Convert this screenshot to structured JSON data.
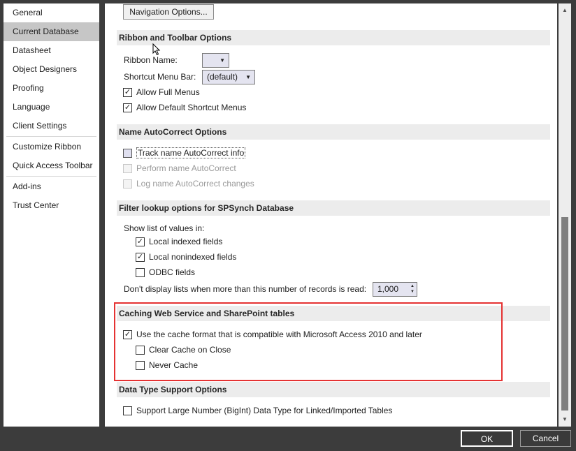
{
  "sidebar": {
    "items": [
      {
        "label": "General"
      },
      {
        "label": "Current Database",
        "selected": true
      },
      {
        "label": "Datasheet"
      },
      {
        "label": "Object Designers"
      },
      {
        "label": "Proofing"
      },
      {
        "label": "Language"
      },
      {
        "label": "Client Settings"
      },
      {
        "label": "Customize Ribbon"
      },
      {
        "label": "Quick Access Toolbar"
      },
      {
        "label": "Add-ins"
      },
      {
        "label": "Trust Center"
      }
    ]
  },
  "nav_options_button": "Navigation Options...",
  "ribbon": {
    "header": "Ribbon and Toolbar Options",
    "ribbon_name_label": "Ribbon Name:",
    "ribbon_name_value": "",
    "shortcut_menu_label": "Shortcut Menu Bar:",
    "shortcut_menu_value": "(default)",
    "allow_full_menus": "Allow Full Menus",
    "allow_default_shortcut": "Allow Default Shortcut Menus"
  },
  "autocorrect": {
    "header": "Name AutoCorrect Options",
    "track": "Track name AutoCorrect info",
    "perform": "Perform name AutoCorrect",
    "log": "Log name AutoCorrect changes"
  },
  "filter": {
    "header": "Filter lookup options for SPSynch Database",
    "show_list": "Show list of values in:",
    "local_indexed": "Local indexed fields",
    "local_nonindexed": "Local nonindexed fields",
    "odbc": "ODBC fields",
    "dont_display": "Don't display lists when more than this number of records is read:",
    "records_value": "1,000"
  },
  "caching": {
    "header": "Caching Web Service and SharePoint tables",
    "use_cache": "Use the cache format that is compatible with Microsoft Access 2010 and later",
    "clear_cache": "Clear Cache on Close",
    "never_cache": "Never Cache"
  },
  "datatype": {
    "header": "Data Type Support Options",
    "bigint": "Support Large Number (BigInt) Data Type for Linked/Imported Tables"
  },
  "footer": {
    "ok": "OK",
    "cancel": "Cancel"
  },
  "glyphs": {
    "check": "✓",
    "dropdown_arrow": "▼",
    "spin_up": "▲",
    "spin_down": "▼",
    "scroll_up": "▲",
    "scroll_down": "▼"
  },
  "colors": {
    "highlight": "#e53232",
    "selected_nav": "#c6c6c6",
    "section_header_bg": "#ececec"
  }
}
